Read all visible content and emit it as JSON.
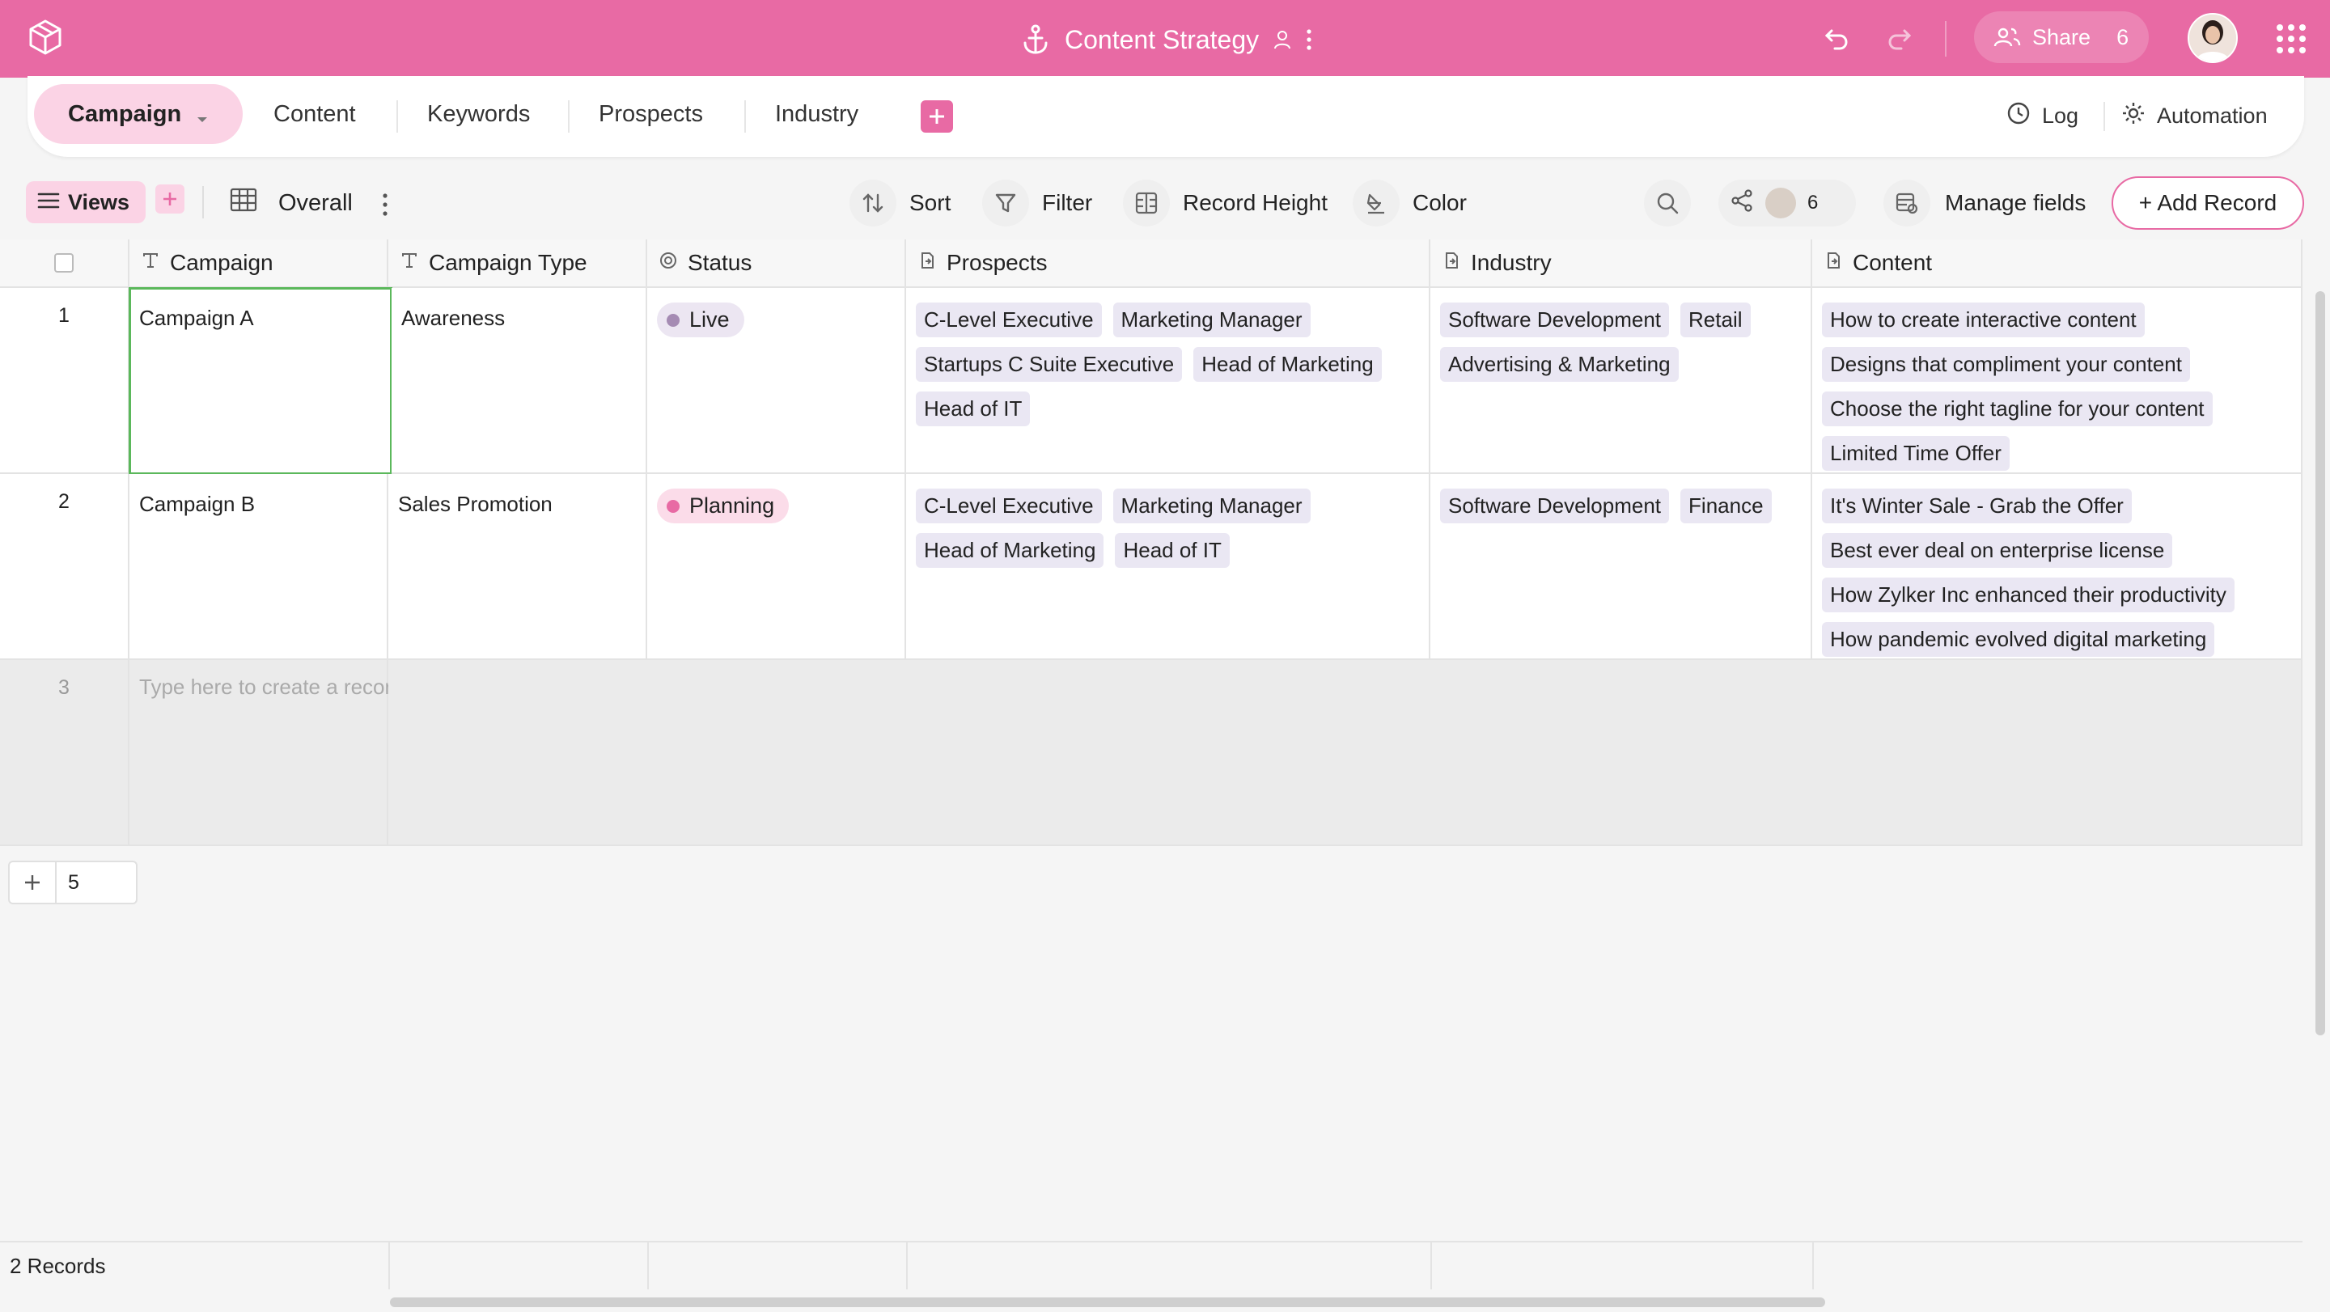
{
  "app": {
    "title": "Content Strategy",
    "share_label": "Share",
    "share_count": "6",
    "accent": "#e86aa4"
  },
  "tabs": [
    {
      "label": "Campaign",
      "active": true
    },
    {
      "label": "Content"
    },
    {
      "label": "Keywords"
    },
    {
      "label": "Prospects"
    },
    {
      "label": "Industry"
    }
  ],
  "top_right": {
    "log": "Log",
    "automation": "Automation"
  },
  "toolbar": {
    "views": "Views",
    "view_name": "Overall",
    "sort": "Sort",
    "filter": "Filter",
    "record_height": "Record Height",
    "color": "Color",
    "collaborators": "6",
    "manage_fields": "Manage fields",
    "add_record": "+ Add Record"
  },
  "columns": [
    {
      "label": "Campaign",
      "icon": "text-field-icon"
    },
    {
      "label": "Campaign Type",
      "icon": "text-field-icon"
    },
    {
      "label": "Status",
      "icon": "status-icon"
    },
    {
      "label": "Prospects",
      "icon": "link-field-icon"
    },
    {
      "label": "Industry",
      "icon": "link-field-icon"
    },
    {
      "label": "Content",
      "icon": "link-field-icon"
    }
  ],
  "rows": [
    {
      "num": "1",
      "campaign": "Campaign A",
      "type": "Awareness",
      "status": "Live",
      "status_color": "#a58bb3",
      "status_bg": "#ece6f2",
      "prospects": [
        "C-Level Executive",
        "Marketing Manager",
        "Startups C Suite Executive",
        "Head of Marketing",
        "Head of IT"
      ],
      "industry": [
        "Software Development",
        "Retail",
        "Advertising & Marketing"
      ],
      "content": [
        "How to create interactive content",
        "Designs that compliment your content",
        "Choose the right tagline for your content",
        "Limited Time Offer"
      ]
    },
    {
      "num": "2",
      "campaign": "Campaign B",
      "type": "Sales Promotion",
      "status": "Planning",
      "status_color": "#e86aa4",
      "status_bg": "#fbdce9",
      "prospects": [
        "C-Level Executive",
        "Marketing Manager",
        "Head of Marketing",
        "Head of IT"
      ],
      "industry": [
        "Software Development",
        "Finance"
      ],
      "content": [
        "It's Winter Sale - Grab the Offer",
        "Best ever deal on enterprise license",
        "How Zylker Inc enhanced their productivity",
        "How pandemic evolved digital marketing"
      ]
    }
  ],
  "new_row": {
    "num": "3",
    "placeholder": "Type here to create a record"
  },
  "footer": {
    "add_count": "5",
    "records": "2 Records"
  }
}
